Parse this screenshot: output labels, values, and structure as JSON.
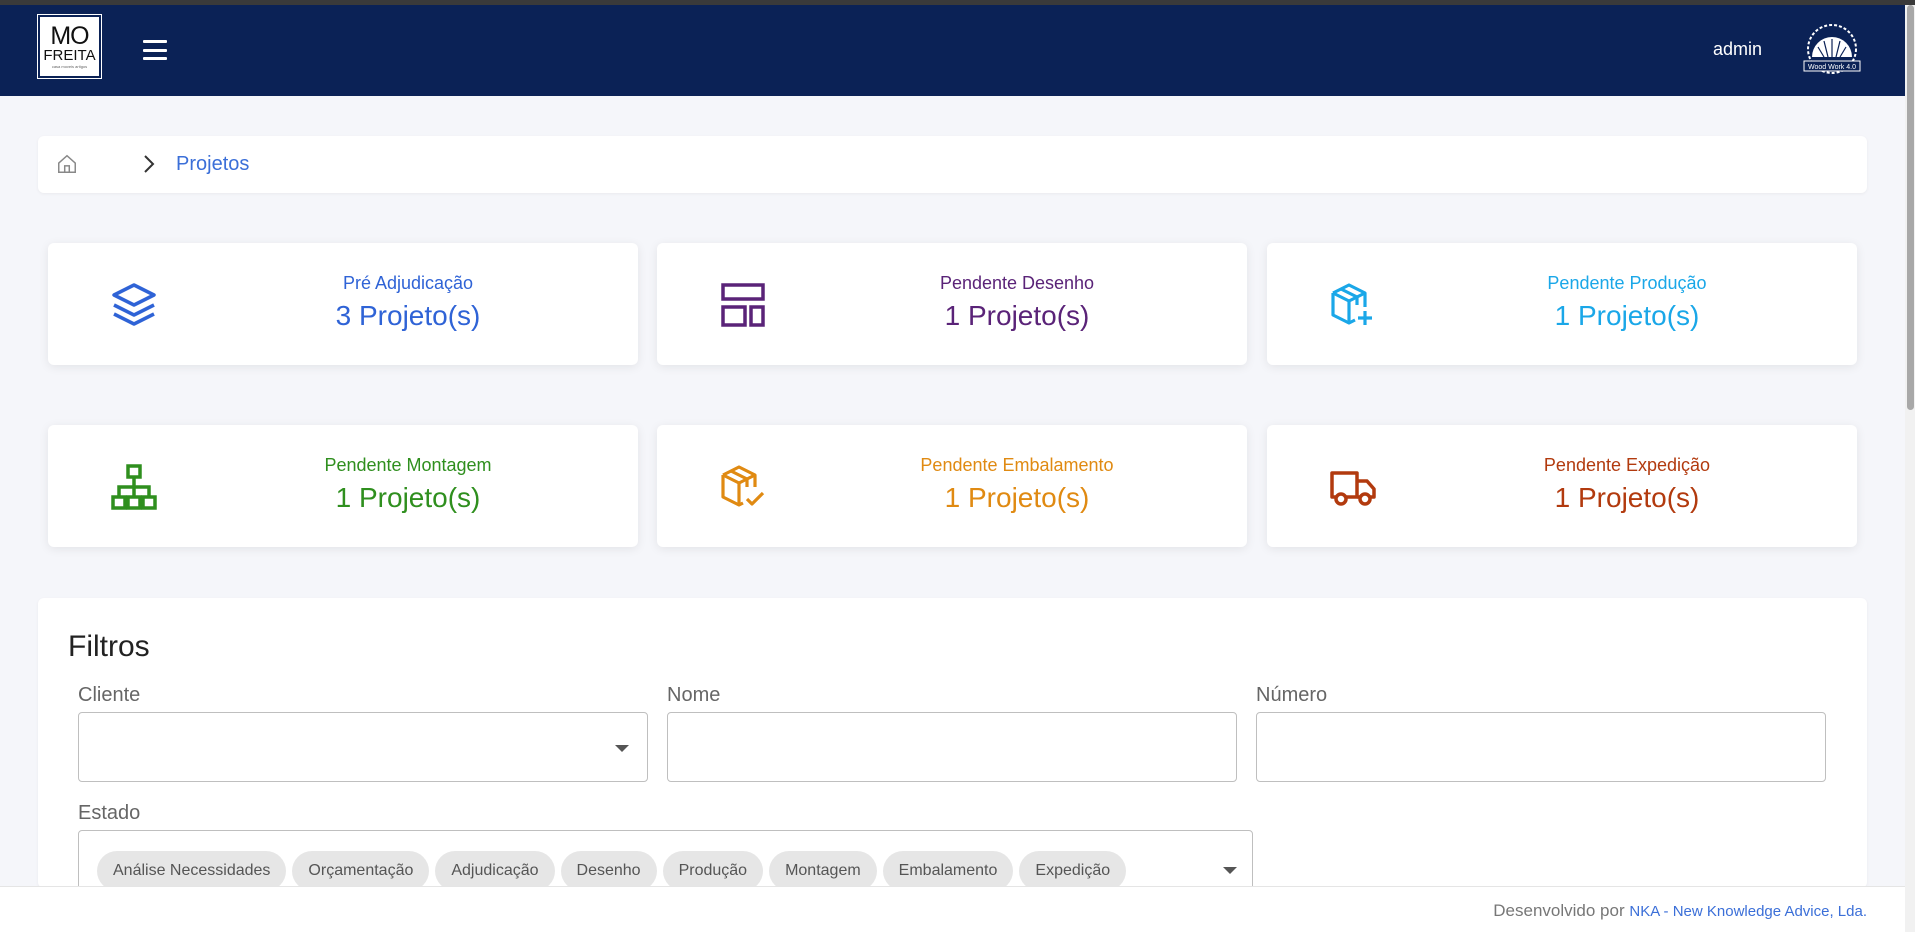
{
  "header": {
    "logo_line1": "MO",
    "logo_line2": "FREITA",
    "logo_line3": "casa moveis artigos",
    "user": "admin",
    "brand_text": "Wood Work 4.0",
    "bg_color": "#0b2256"
  },
  "breadcrumb": {
    "current": "Projetos"
  },
  "cards": [
    {
      "title": "Pré Adjudicação",
      "count": "3 Projeto(s)",
      "color": "#2f63d6",
      "icon": "layers-icon"
    },
    {
      "title": "Pendente Desenho",
      "count": "1 Projeto(s)",
      "color": "#5a2378",
      "icon": "layout-icon"
    },
    {
      "title": "Pendente Produção",
      "count": "1 Projeto(s)",
      "color": "#1aa7e8",
      "icon": "box-plus-icon"
    },
    {
      "title": "Pendente Montagem",
      "count": "1 Projeto(s)",
      "color": "#2f8f1e",
      "icon": "sitemap-icon"
    },
    {
      "title": "Pendente Embalamento",
      "count": "1 Projeto(s)",
      "color": "#e08a12",
      "icon": "box-check-icon"
    },
    {
      "title": "Pendente Expedição",
      "count": "1 Projeto(s)",
      "color": "#b23a0e",
      "icon": "truck-icon"
    }
  ],
  "filters": {
    "title": "Filtros",
    "cliente_label": "Cliente",
    "cliente_value": "",
    "nome_label": "Nome",
    "nome_value": "",
    "numero_label": "Número",
    "numero_value": "",
    "estado_label": "Estado",
    "estado_chips": [
      "Análise Necessidades",
      "Orçamentação",
      "Adjudicação",
      "Desenho",
      "Produção",
      "Montagem",
      "Embalamento",
      "Expedição"
    ]
  },
  "footer": {
    "prefix": "Desenvolvido por",
    "link": "NKA - New Knowledge Advice, Lda."
  }
}
